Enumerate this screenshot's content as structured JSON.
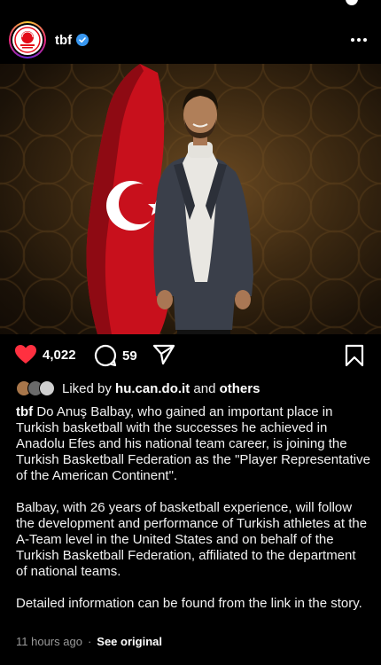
{
  "post": {
    "username": "tbf",
    "verified": true,
    "avatar_icon": "tbf-logo",
    "brand_colors": {
      "flag_red": "#e30a17",
      "like_red": "#ff3040"
    }
  },
  "actions": {
    "likes": "4,022",
    "comments": "59"
  },
  "liked_by": {
    "prefix": "Liked by",
    "user": "hu.can.do.it",
    "conjunction": "and",
    "others": "others"
  },
  "caption": {
    "username": "tbf",
    "paragraph1": "Do Anuş Balbay, who gained an important place in Turkish basketball with the successes he achieved in Anadolu Efes and his national team career, is joining the Turkish Basketball Federation as the \"Player Representative of the American Continent\".",
    "paragraph2": "Balbay, with 26 years of basketball experience, will follow the development and performance of Turkish athletes at the A-Team level in the United States and on behalf of the Turkish Basketball Federation, affiliated to the department of national teams.",
    "paragraph3": "Detailed information can be found from the link in the story."
  },
  "meta": {
    "time": "11 hours ago",
    "separator": "·",
    "see_original": "See original"
  }
}
